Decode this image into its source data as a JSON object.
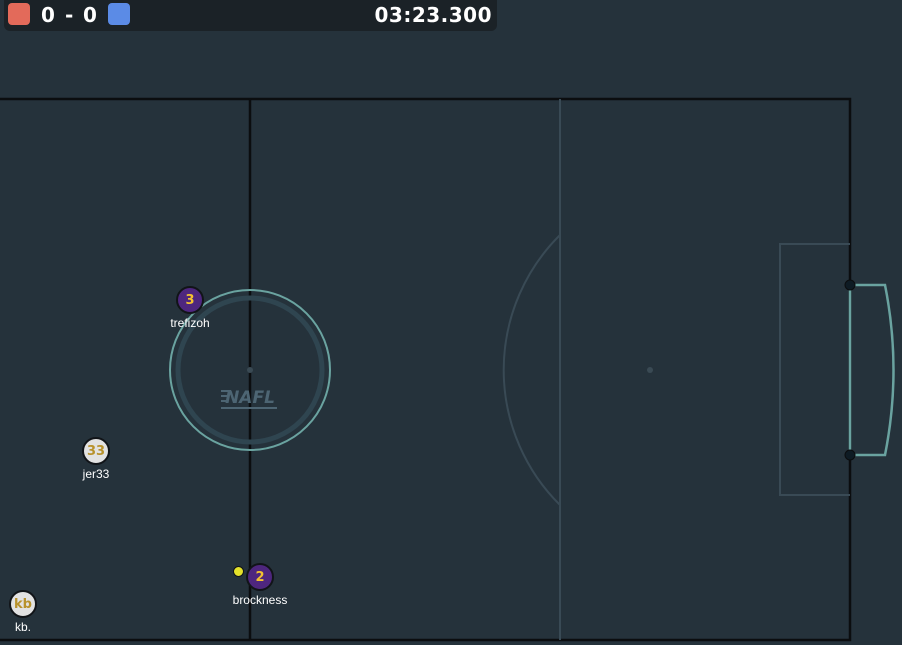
{
  "scoreboard": {
    "red_score": "0",
    "separator": "-",
    "blue_score": "0",
    "timer": "03:23.300",
    "red_color": "#e36a5a",
    "blue_color": "#5b8be6"
  },
  "field": {
    "logo_text": "NAFL",
    "background_color": "#25323b"
  },
  "players": [
    {
      "number": "3",
      "name": "trefizoh",
      "team": "purple"
    },
    {
      "number": "33",
      "name": "jer33",
      "team": "white"
    },
    {
      "number": "2",
      "name": "brockness",
      "team": "purple"
    },
    {
      "number": "kb",
      "name": "kb.",
      "team": "white"
    }
  ]
}
